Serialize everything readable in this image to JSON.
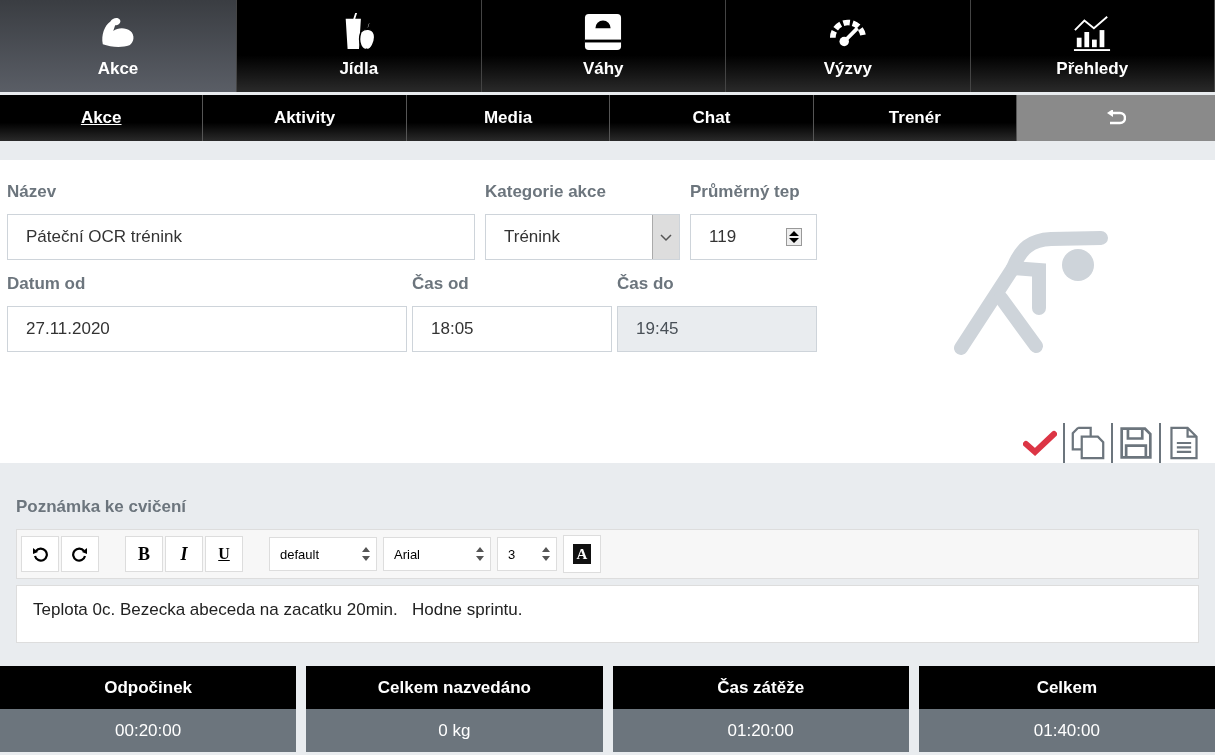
{
  "main_nav": [
    {
      "label": "Akce",
      "kind": "muscle",
      "selected": true
    },
    {
      "label": "Jídla",
      "kind": "food",
      "selected": false
    },
    {
      "label": "Váhy",
      "kind": "scale",
      "selected": false
    },
    {
      "label": "Výzvy",
      "kind": "gauge",
      "selected": false
    },
    {
      "label": "Přehledy",
      "kind": "chart",
      "selected": false
    }
  ],
  "sub_nav": [
    {
      "kind": "tab",
      "label": "Akce",
      "selected": true
    },
    {
      "kind": "tab",
      "label": "Aktivity",
      "selected": false
    },
    {
      "kind": "tab",
      "label": "Media",
      "selected": false
    },
    {
      "kind": "tab",
      "label": "Chat",
      "selected": false
    },
    {
      "kind": "tab",
      "label": "Trenér",
      "selected": false
    },
    {
      "kind": "back"
    }
  ],
  "form": {
    "rows": [
      [
        {
          "label": "Název",
          "kind": "text",
          "value": "Páteční OCR trénink",
          "disabled": false
        },
        {
          "label": "Kategorie akce",
          "kind": "select",
          "value": "Trénink",
          "disabled": false
        },
        {
          "label": "Průměrný tep",
          "kind": "number",
          "value": "119",
          "disabled": false
        }
      ],
      [
        {
          "label": "Datum od",
          "kind": "text",
          "value": "27.11.2020",
          "disabled": false
        },
        {
          "label": "Čas od",
          "kind": "text",
          "value": "18:05",
          "disabled": false
        },
        {
          "label": "Čas do",
          "kind": "text",
          "value": "19:45",
          "disabled": true
        }
      ]
    ]
  },
  "actions": [
    {
      "kind": "confirm"
    },
    {
      "kind": "copy"
    },
    {
      "kind": "save"
    },
    {
      "kind": "document"
    }
  ],
  "note": {
    "label": "Poznámka ke cvičení",
    "toolbar": [
      {
        "kind": "undo"
      },
      {
        "kind": "redo"
      },
      {
        "kind": "gap"
      },
      {
        "kind": "bold",
        "label": "B"
      },
      {
        "kind": "italic",
        "label": "I"
      },
      {
        "kind": "underline",
        "label": "U"
      },
      {
        "kind": "gap"
      },
      {
        "kind": "select",
        "label": "default"
      },
      {
        "kind": "select",
        "label": "Arial"
      },
      {
        "kind": "select",
        "label": "3"
      },
      {
        "kind": "color",
        "label": "A"
      }
    ],
    "text": "Teplota 0c. Bezecka abeceda na zacatku 20min.   Hodne sprintu."
  },
  "stats": [
    {
      "title": "Odpočinek",
      "value": "00:20:00"
    },
    {
      "title": "Celkem nazvedáno",
      "value": "0 kg"
    },
    {
      "title": "Čas zátěže",
      "value": "01:20:00"
    },
    {
      "title": "Celkem",
      "value": "01:40:00"
    }
  ]
}
